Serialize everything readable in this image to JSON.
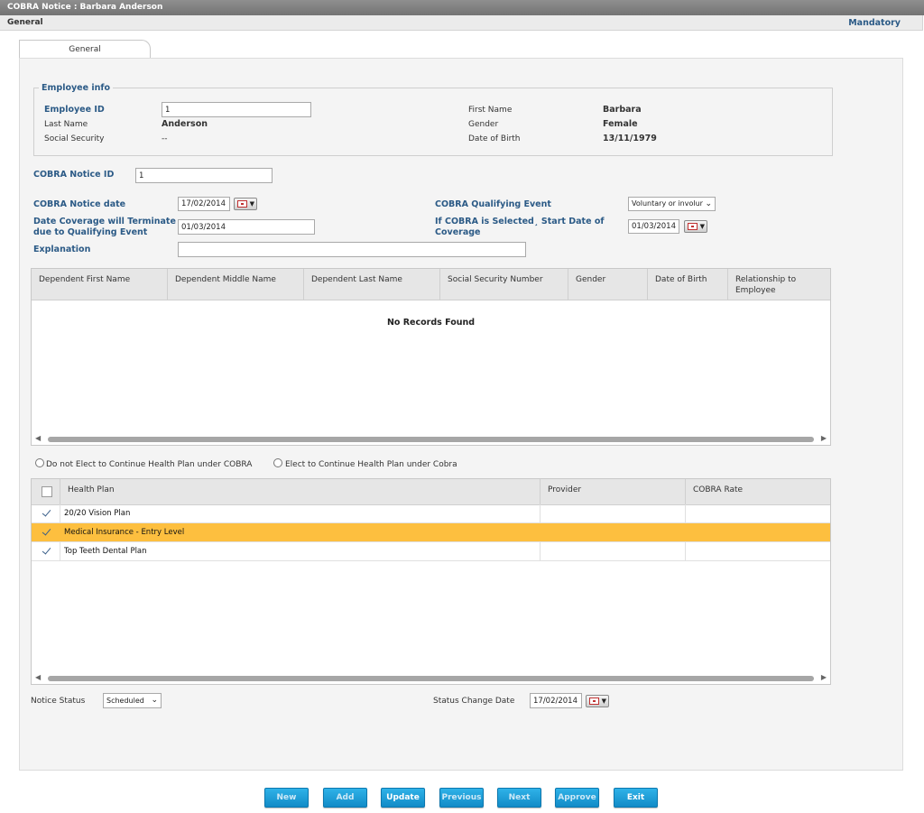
{
  "window": {
    "title": "COBRA Notice :  Barbara Anderson"
  },
  "subbar": {
    "section": "General",
    "mandatory": "Mandatory"
  },
  "tabs": [
    {
      "label": "General"
    }
  ],
  "employee_info": {
    "legend": "Employee info",
    "employee_id_label": "Employee ID",
    "employee_id_value": "1",
    "last_name_label": "Last Name",
    "last_name_value": "Anderson",
    "ssn_label": "Social Security",
    "ssn_value": "--",
    "first_name_label": "First Name",
    "first_name_value": "Barbara",
    "gender_label": "Gender",
    "gender_value": "Female",
    "dob_label": "Date of Birth",
    "dob_value": "13/11/1979"
  },
  "notice": {
    "id_label": "COBRA Notice ID",
    "id_value": "1",
    "date_label": "COBRA Notice date",
    "date_value": "17/02/2014",
    "qualifying_event_label": "COBRA Qualifying Event",
    "qualifying_event_value": "Voluntary or involur",
    "terminate_label_1": "Date Coverage will Terminate",
    "terminate_label_2": "due to Qualifying Event",
    "terminate_value": "01/03/2014",
    "start_label_1": "If COBRA is Selected¸ Start Date of",
    "start_label_2": "Coverage",
    "start_value": "01/03/2014",
    "explanation_label": "Explanation",
    "explanation_value": ""
  },
  "dependents_grid": {
    "columns": [
      "Dependent First Name",
      "Dependent Middle Name",
      "Dependent Last Name",
      "Social Security Number",
      "Gender",
      "Date of Birth",
      "Relationship to Employee"
    ],
    "empty_text": "No Records Found"
  },
  "election": {
    "option_decline": "Do not Elect to Continue Health Plan under COBRA",
    "option_elect": "Elect to Continue Health Plan under Cobra"
  },
  "plans_grid": {
    "columns": [
      "Health Plan",
      "Provider",
      "COBRA Rate"
    ],
    "rows": [
      {
        "plan": "20/20 Vision Plan",
        "provider": "",
        "rate": ""
      },
      {
        "plan": "Medical Insurance - Entry Level",
        "provider": "",
        "rate": ""
      },
      {
        "plan": "Top Teeth Dental Plan",
        "provider": "",
        "rate": ""
      }
    ]
  },
  "status": {
    "notice_status_label": "Notice Status",
    "notice_status_value": "Scheduled",
    "change_date_label": "Status Change Date",
    "change_date_value": "17/02/2014"
  },
  "buttons": {
    "new": "New",
    "add": "Add",
    "update": "Update",
    "previous": "Previous",
    "next": "Next",
    "approve": "Approve",
    "exit": "Exit"
  },
  "colors": {
    "accent": "#2b5a86",
    "highlight_row": "#fdbf3f",
    "button": "#1a9ad6"
  }
}
